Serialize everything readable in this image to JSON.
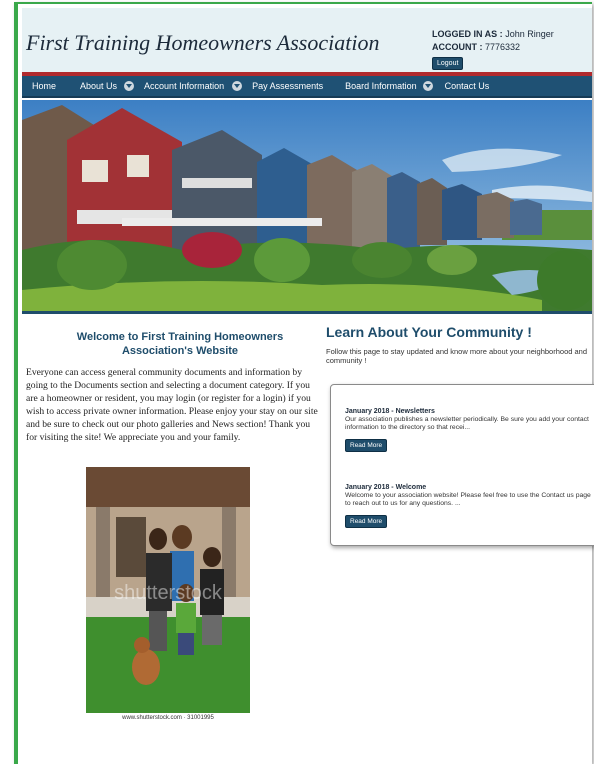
{
  "header": {
    "site_title": "First Training Homeowners Association",
    "logged_in_label": "LOGGED IN AS :",
    "logged_in_user": "John Ringer",
    "account_label": "ACCOUNT :",
    "account_number": "7776332",
    "logout_label": "Logout"
  },
  "nav": {
    "items": [
      {
        "label": "Home"
      },
      {
        "label": "About Us",
        "dropdown": true
      },
      {
        "label": "Account Information",
        "dropdown": true
      },
      {
        "label": "Pay Assessments"
      },
      {
        "label": "Board Information",
        "dropdown": true
      },
      {
        "label": "Contact Us"
      }
    ]
  },
  "welcome": {
    "title": "Welcome to First Training Homeowners Association's Website",
    "body": "Everyone can access general community documents and information by going to the Documents section and selecting a document category. If you are a homeowner or resident, you may login (or register for a login) if you wish to access private owner information. Please enjoy your stay on our site and be sure to check out our photo galleries and News section! Thank you for visiting the site! We appreciate you and your family."
  },
  "photo": {
    "watermark": "shutterstock",
    "caption": "www.shutterstock.com · 31001995"
  },
  "community": {
    "title": "Learn About Your Community !",
    "subtitle": "Follow this page to stay updated and know more about your neighborhood and community !",
    "news": [
      {
        "title": "January 2018 - Newsletters",
        "text": "Our association publishes a newsletter periodically.  Be sure you add your contact information to the directory so that recei...",
        "button": "Read More"
      },
      {
        "title": "January 2018 - Welcome",
        "text": "Welcome to your association website! Please feel free to use the Contact us page to reach out to us for any questions.  ...",
        "button": "Read More"
      }
    ]
  },
  "colors": {
    "accent_green": "#3aa84a",
    "nav_blue": "#1f5174",
    "header_bg": "#e6f1f4",
    "red_stripe": "#b12a2e"
  }
}
